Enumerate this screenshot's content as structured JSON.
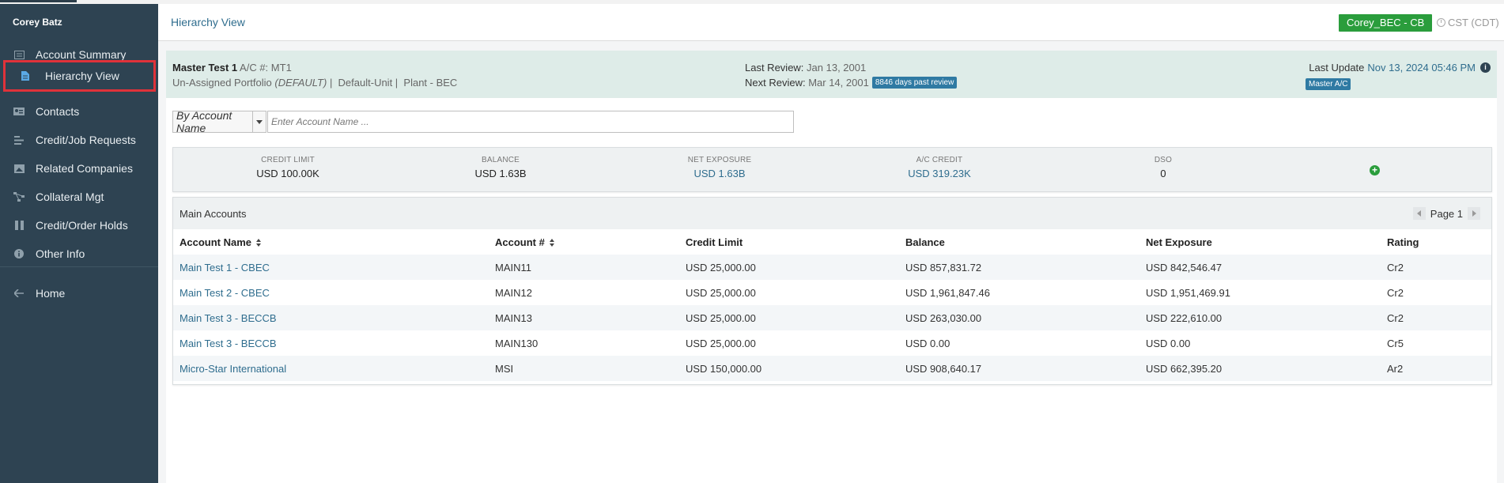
{
  "sidebar": {
    "user": "Corey Batz",
    "items": [
      {
        "label": "Account Summary",
        "icon": "summary-icon"
      },
      {
        "label": "Hierarchy View",
        "icon": "document-icon",
        "active": true
      },
      {
        "label": "Contacts",
        "icon": "contact-card-icon"
      },
      {
        "label": "Credit/Job Requests",
        "icon": "list-icon"
      },
      {
        "label": "Related Companies",
        "icon": "related-icon"
      },
      {
        "label": "Collateral Mgt",
        "icon": "share-icon"
      },
      {
        "label": "Credit/Order Holds",
        "icon": "columns-icon"
      },
      {
        "label": "Other Info",
        "icon": "info-icon"
      }
    ],
    "home_label": "Home"
  },
  "header": {
    "breadcrumb": "Hierarchy View",
    "context_button": "Corey_BEC - CB",
    "timezone": "CST (CDT)"
  },
  "account": {
    "name": "Master Test 1",
    "ac_label": "A/C #:",
    "ac_number": "MT1",
    "portfolio": "Un-Assigned Portfolio",
    "portfolio_note": "(DEFAULT)",
    "unit": "Default-Unit",
    "plant": "Plant - BEC",
    "last_review_label": "Last Review:",
    "last_review": "Jan 13, 2001",
    "next_review_label": "Next Review:",
    "next_review": "Mar 14, 2001",
    "past_review_badge": "8846 days past review",
    "last_update_label": "Last Update",
    "last_update": "Nov 13, 2024 05:46 PM",
    "master_badge": "Master A/C"
  },
  "search": {
    "mode": "By Account Name",
    "placeholder": "Enter Account Name ..."
  },
  "summary": {
    "credit_limit_label": "CREDIT LIMIT",
    "credit_limit": "USD 100.00K",
    "balance_label": "BALANCE",
    "balance": "USD 1.63B",
    "net_exposure_label": "NET EXPOSURE",
    "net_exposure": "USD 1.63B",
    "ac_credit_label": "A/C CREDIT",
    "ac_credit": "USD 319.23K",
    "dso_label": "DSO",
    "dso": "0"
  },
  "table": {
    "title": "Main Accounts",
    "page_label": "Page 1",
    "columns": [
      "Account Name",
      "Account #",
      "Credit Limit",
      "Balance",
      "Net Exposure",
      "Rating"
    ],
    "rows": [
      [
        "Main Test 1 - CBEC",
        "MAIN11",
        "USD 25,000.00",
        "USD 857,831.72",
        "USD 842,546.47",
        "Cr2"
      ],
      [
        "Main Test 2 - CBEC",
        "MAIN12",
        "USD 25,000.00",
        "USD 1,961,847.46",
        "USD 1,951,469.91",
        "Cr2"
      ],
      [
        "Main Test 3 - BECCB",
        "MAIN13",
        "USD 25,000.00",
        "USD 263,030.00",
        "USD 222,610.00",
        "Cr2"
      ],
      [
        "Main Test 3 - BECCB",
        "MAIN130",
        "USD 25,000.00",
        "USD 0.00",
        "USD 0.00",
        "Cr5"
      ],
      [
        "Micro-Star International",
        "MSI",
        "USD 150,000.00",
        "USD 908,640.17",
        "USD 662,395.20",
        "Ar2"
      ]
    ]
  }
}
